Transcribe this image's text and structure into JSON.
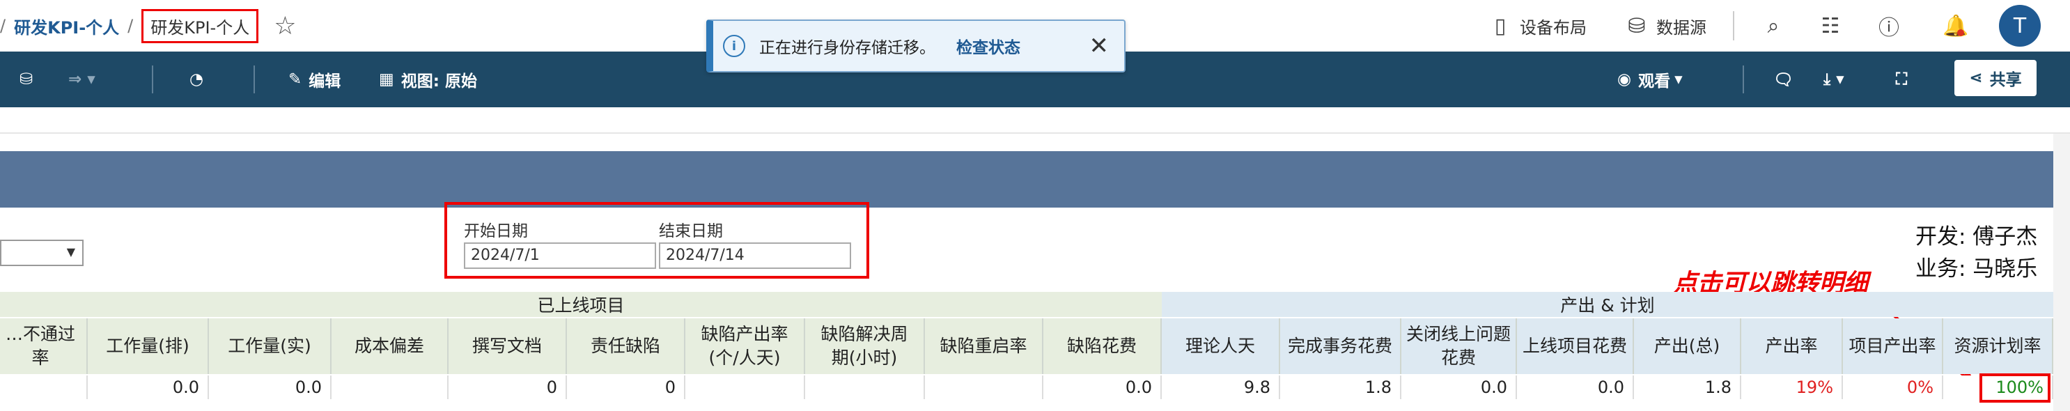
{
  "breadcrumb": {
    "sep": "/",
    "parent": "研发KPI-个人",
    "current": "研发KPI-个人"
  },
  "topright": {
    "device_layout": "设备布局",
    "data_source": "数据源",
    "avatar": "T"
  },
  "toolbar": {
    "edit": "编辑",
    "view": "视图: 原始",
    "watch": "观看",
    "share": "共享"
  },
  "toast": {
    "message": "正在进行身份存储迁移。",
    "action": "检查状态"
  },
  "filters": {
    "start_label": "开始日期",
    "start_value": "2024/7/1",
    "end_label": "结束日期",
    "end_value": "2024/7/14"
  },
  "people": {
    "dev": "开发: 傅子杰",
    "biz": "业务: 马晓乐"
  },
  "annotation": "点击可以跳转明细",
  "table": {
    "groups": [
      "已上线项目",
      "产出 & 计划"
    ],
    "headers": [
      "…不通过率",
      "工作量(排)",
      "工作量(实)",
      "成本偏差",
      "撰写文档",
      "责任缺陷",
      "缺陷产出率\n(个/人天)",
      "缺陷解决周\n期(小时)",
      "缺陷重启率",
      "缺陷花费",
      "理论人天",
      "完成事务花费",
      "关闭线上问题\n花费",
      "上线项目花费",
      "产出(总)",
      "产出率",
      "项目产出率",
      "资源计划率"
    ],
    "values": [
      "",
      "0.0",
      "0.0",
      "",
      "0",
      "0",
      "",
      "",
      "",
      "0.0",
      "9.8",
      "1.8",
      "0.0",
      "0.0",
      "1.8",
      "19%",
      "0%",
      "100%"
    ]
  },
  "colors": {
    "red": "#e02020",
    "green": "#1a8a1a"
  }
}
